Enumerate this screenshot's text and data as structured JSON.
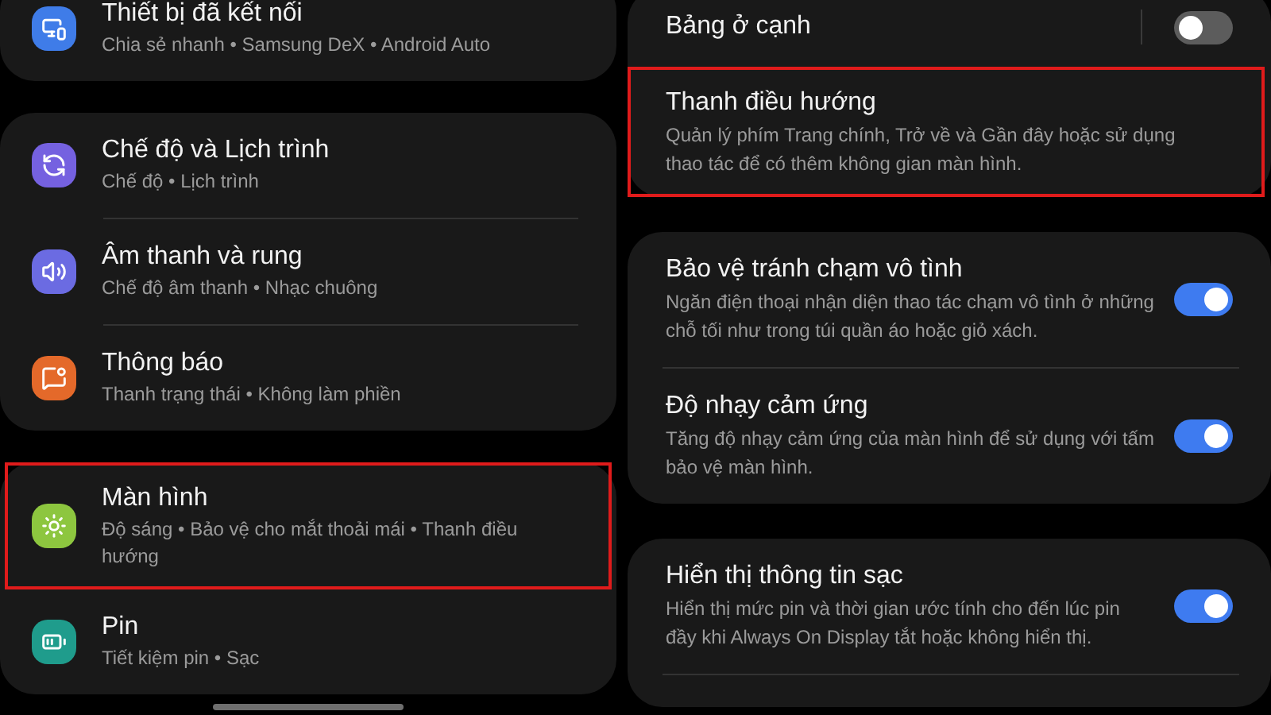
{
  "left_screen": {
    "groups": [
      {
        "items": [
          {
            "kind": "devices",
            "color": "#3f7ce8",
            "title": "Thiết bị đã kết nối",
            "subtitle": "Chia sẻ nhanh • Samsung DeX • Android Auto",
            "highlighted": false
          }
        ]
      },
      {
        "items": [
          {
            "kind": "modes",
            "color": "#7561e0",
            "title": "Chế độ và Lịch trình",
            "subtitle": "Chế độ • Lịch trình",
            "highlighted": false
          },
          {
            "kind": "sound",
            "color": "#6b6be2",
            "title": "Âm thanh và rung",
            "subtitle": "Chế độ âm thanh • Nhạc chuông",
            "highlighted": false
          },
          {
            "kind": "notifications",
            "color": "#e4692a",
            "title": "Thông báo",
            "subtitle": "Thanh trạng thái • Không làm phiền",
            "highlighted": false
          }
        ]
      },
      {
        "items": [
          {
            "kind": "display",
            "color": "#8dc63f",
            "title": "Màn hình",
            "subtitle": "Độ sáng • Bảo vệ cho mắt thoải mái • Thanh điều hướng",
            "highlighted": true
          },
          {
            "kind": "battery",
            "color": "#1f9c8c",
            "title": "Pin",
            "subtitle": "Tiết kiệm pin • Sạc",
            "highlighted": false
          }
        ]
      }
    ]
  },
  "right_screen": {
    "groups": [
      {
        "items": [
          {
            "kind": "toggle",
            "title": "Bảng ở cạnh",
            "on": false,
            "highlighted": false
          },
          {
            "kind": "link",
            "title": "Thanh điều hướng",
            "description": "Quản lý phím Trang chính, Trở về và Gần đây hoặc sử dụng thao tác để có thêm không gian màn hình.",
            "highlighted": true
          }
        ]
      },
      {
        "items": [
          {
            "kind": "toggle",
            "title": "Bảo vệ tránh chạm vô tình",
            "description": "Ngăn điện thoại nhận diện thao tác chạm vô tình ở những chỗ tối như trong túi quần áo hoặc giỏ xách.",
            "on": true,
            "highlighted": false
          },
          {
            "kind": "toggle",
            "title": "Độ nhạy cảm ứng",
            "description": "Tăng độ nhạy cảm ứng của màn hình để sử dụng với tấm bảo vệ màn hình.",
            "on": true,
            "highlighted": false
          }
        ]
      },
      {
        "items": [
          {
            "kind": "toggle",
            "title": "Hiển thị thông tin sạc",
            "description": "Hiển thị mức pin và thời gian ước tính cho đến lúc pin đầy khi Always On Display tắt hoặc không hiển thị.",
            "on": true,
            "highlighted": false
          }
        ]
      }
    ]
  }
}
